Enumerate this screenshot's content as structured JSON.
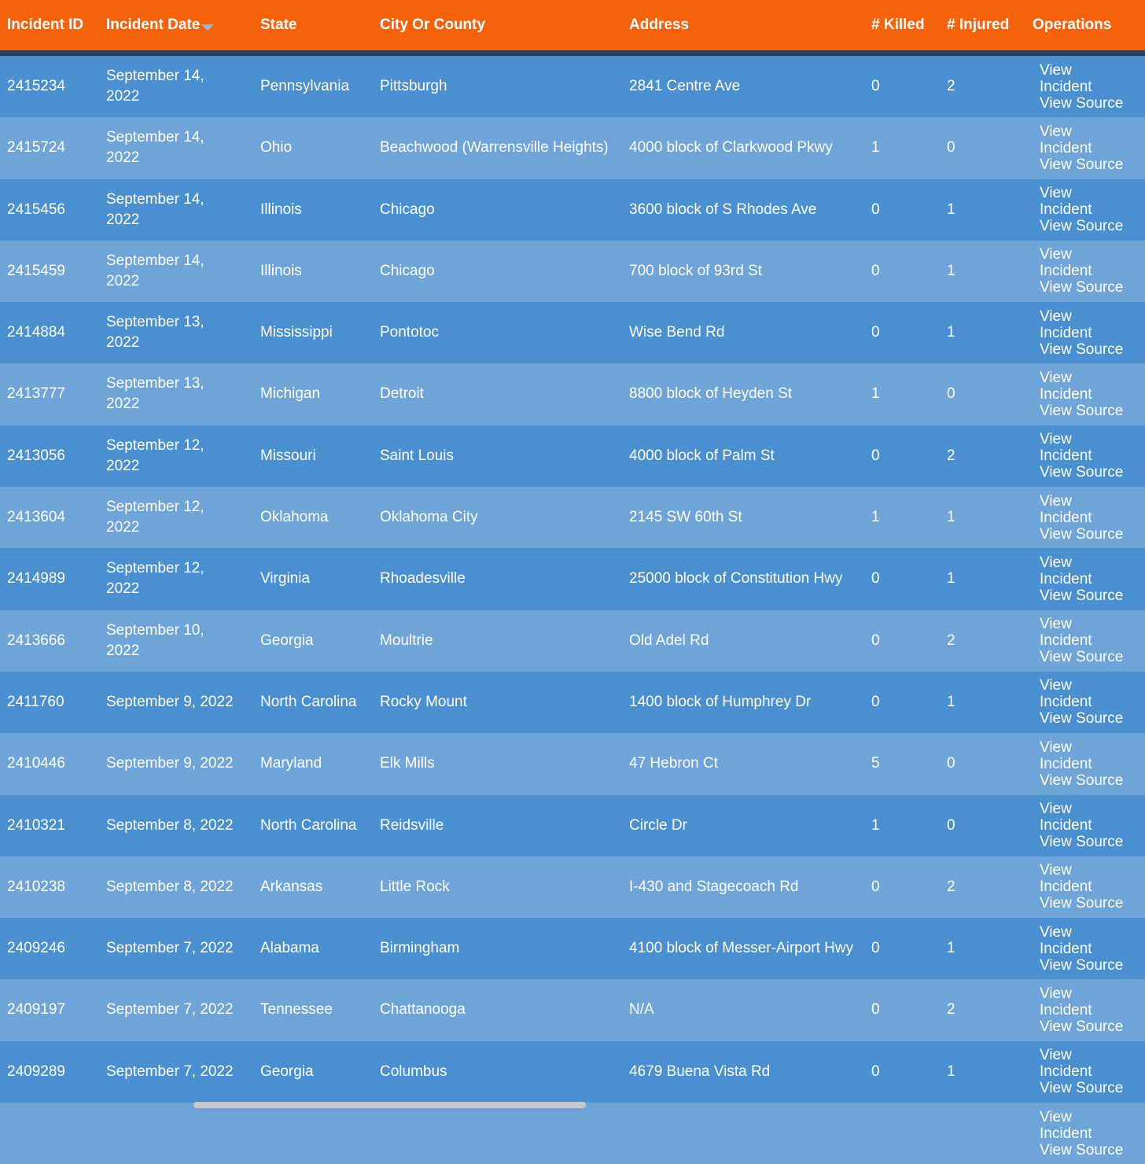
{
  "table": {
    "headers": {
      "incident_id": "Incident ID",
      "incident_date": "Incident Date",
      "state": "State",
      "city_or_county": "City Or County",
      "address": "Address",
      "killed": "# Killed",
      "injured": "# Injured",
      "operations": "Operations"
    },
    "sort_icon": "sort-descending-icon",
    "operations_labels": {
      "view_incident": "View Incident",
      "view_source": "View Source"
    },
    "rows": [
      {
        "id": "2415234",
        "date": "September 14, 2022",
        "state": "Pennsylvania",
        "city": "Pittsburgh",
        "address": "2841 Centre Ave",
        "killed": "0",
        "injured": "2"
      },
      {
        "id": "2415724",
        "date": "September 14, 2022",
        "state": "Ohio",
        "city": "Beachwood (Warrensville Heights)",
        "address": "4000 block of Clarkwood Pkwy",
        "killed": "1",
        "injured": "0"
      },
      {
        "id": "2415456",
        "date": "September 14, 2022",
        "state": "Illinois",
        "city": "Chicago",
        "address": "3600 block of S Rhodes Ave",
        "killed": "0",
        "injured": "1"
      },
      {
        "id": "2415459",
        "date": "September 14, 2022",
        "state": "Illinois",
        "city": "Chicago",
        "address": "700 block of 93rd St",
        "killed": "0",
        "injured": "1"
      },
      {
        "id": "2414884",
        "date": "September 13, 2022",
        "state": "Mississippi",
        "city": "Pontotoc",
        "address": "Wise Bend Rd",
        "killed": "0",
        "injured": "1"
      },
      {
        "id": "2413777",
        "date": "September 13, 2022",
        "state": "Michigan",
        "city": "Detroit",
        "address": "8800 block of Heyden St",
        "killed": "1",
        "injured": "0"
      },
      {
        "id": "2413056",
        "date": "September 12, 2022",
        "state": "Missouri",
        "city": "Saint Louis",
        "address": "4000 block of Palm St",
        "killed": "0",
        "injured": "2"
      },
      {
        "id": "2413604",
        "date": "September 12, 2022",
        "state": "Oklahoma",
        "city": "Oklahoma City",
        "address": "2145 SW 60th St",
        "killed": "1",
        "injured": "1"
      },
      {
        "id": "2414989",
        "date": "September 12, 2022",
        "state": "Virginia",
        "city": "Rhoadesville",
        "address": "25000 block of Constitution Hwy",
        "killed": "0",
        "injured": "1"
      },
      {
        "id": "2413666",
        "date": "September 10, 2022",
        "state": "Georgia",
        "city": "Moultrie",
        "address": "Old Adel Rd",
        "killed": "0",
        "injured": "2"
      },
      {
        "id": "2411760",
        "date": "September 9, 2022",
        "state": "North Carolina",
        "city": "Rocky Mount",
        "address": "1400 block of Humphrey Dr",
        "killed": "0",
        "injured": "1"
      },
      {
        "id": "2410446",
        "date": "September 9, 2022",
        "state": "Maryland",
        "city": "Elk Mills",
        "address": "47 Hebron Ct",
        "killed": "5",
        "injured": "0"
      },
      {
        "id": "2410321",
        "date": "September 8, 2022",
        "state": "North Carolina",
        "city": "Reidsville",
        "address": "Circle Dr",
        "killed": "1",
        "injured": "0"
      },
      {
        "id": "2410238",
        "date": "September 8, 2022",
        "state": "Arkansas",
        "city": "Little Rock",
        "address": "I-430 and Stagecoach Rd",
        "killed": "0",
        "injured": "2"
      },
      {
        "id": "2409246",
        "date": "September 7, 2022",
        "state": "Alabama",
        "city": "Birmingham",
        "address": "4100 block of Messer-Airport Hwy",
        "killed": "0",
        "injured": "1"
      },
      {
        "id": "2409197",
        "date": "September 7, 2022",
        "state": "Tennessee",
        "city": "Chattanooga",
        "address": "N/A",
        "killed": "0",
        "injured": "2"
      },
      {
        "id": "2409289",
        "date": "September 7, 2022",
        "state": "Georgia",
        "city": "Columbus",
        "address": "4679 Buena Vista Rd",
        "killed": "0",
        "injured": "1"
      },
      {
        "id": "",
        "date": "",
        "state": "",
        "city": "",
        "address": "",
        "killed": "",
        "injured": ""
      }
    ]
  },
  "colors": {
    "header_bg": "#f5620a",
    "header_rule": "#2f3f55",
    "row_dark": "#4a8fcf",
    "row_light": "#6fa4d8",
    "text": "#ffffff",
    "scrollbar": "#c9c9c9"
  }
}
